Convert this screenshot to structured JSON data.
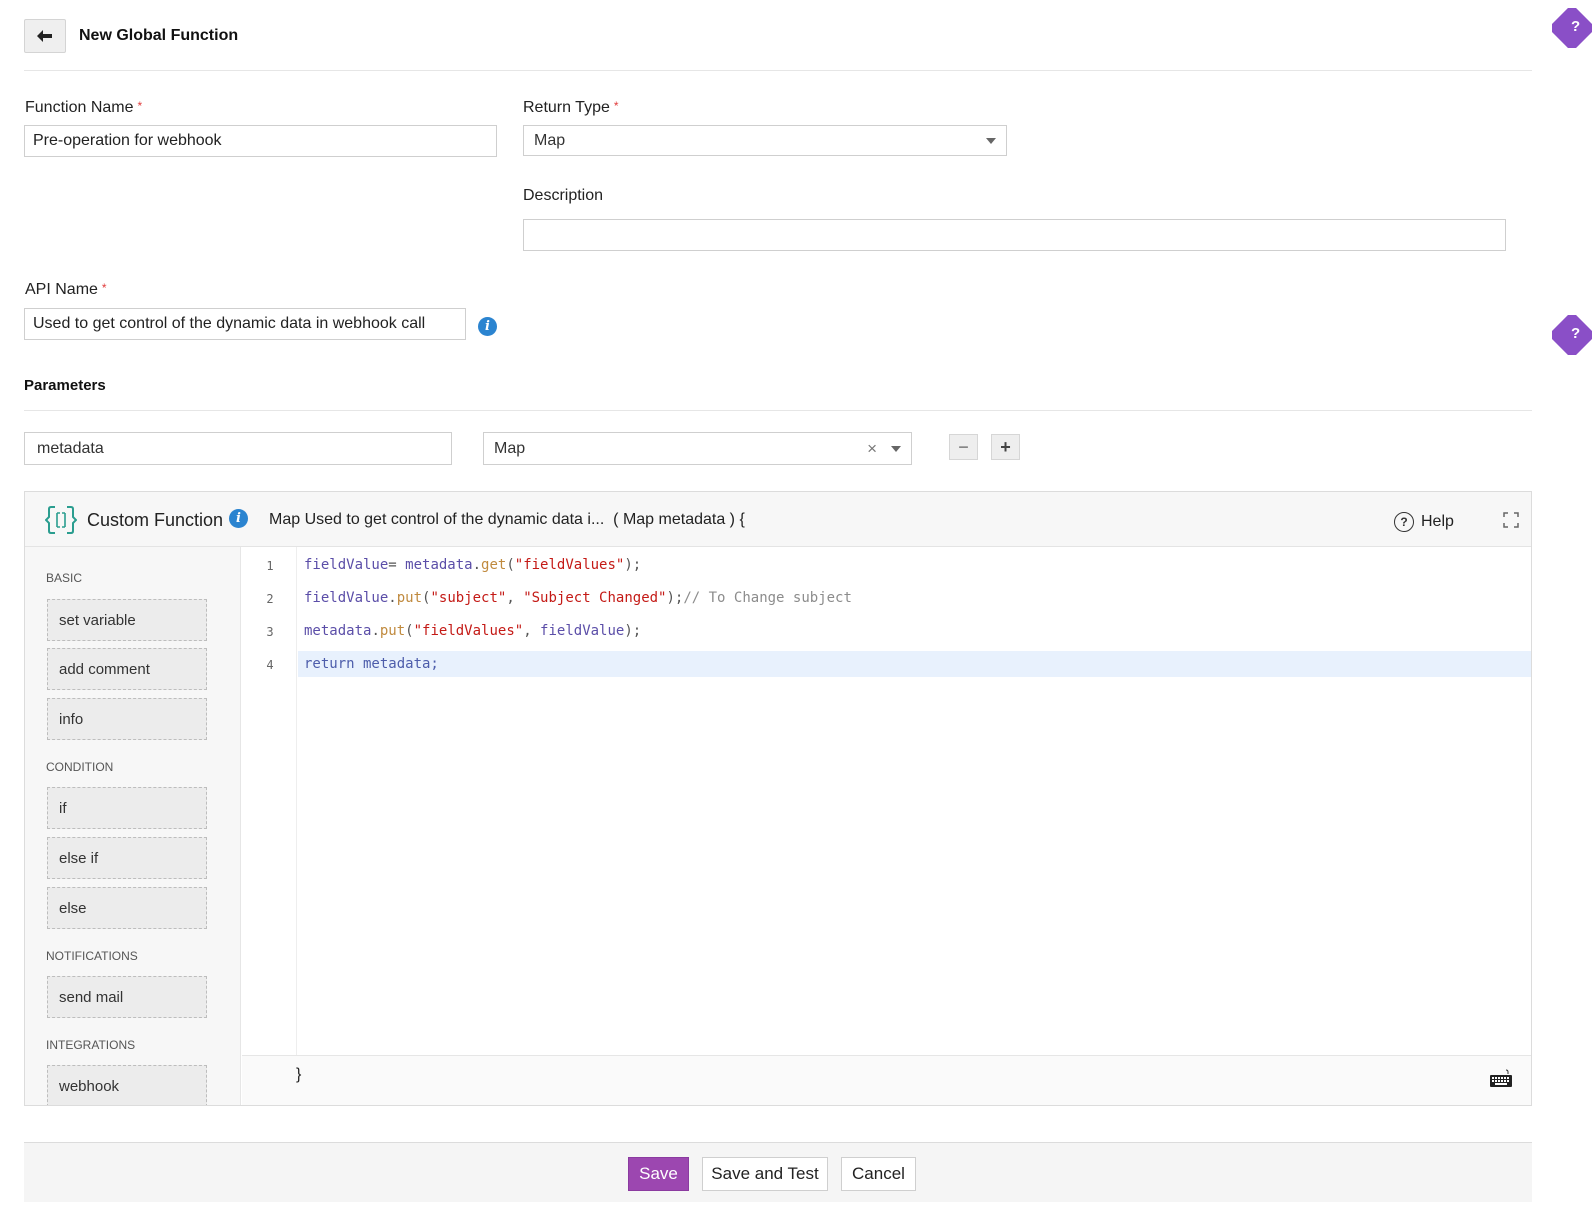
{
  "header": {
    "title": "New Global Function"
  },
  "form": {
    "function_name": {
      "label": "Function Name",
      "required": "*",
      "value": "Pre-operation for webhook"
    },
    "return_type": {
      "label": "Return Type",
      "required": "*",
      "value": "Map"
    },
    "description": {
      "label": "Description",
      "value": ""
    },
    "api_name": {
      "label": "API Name",
      "required": "*",
      "value": "Used to get control of the dynamic data in webhook call",
      "info_icon": "i"
    }
  },
  "parameters": {
    "title": "Parameters",
    "rows": [
      {
        "name": "metadata",
        "type": "Map",
        "clear": "×"
      }
    ],
    "remove_label": "−",
    "add_label": "+"
  },
  "editor": {
    "title": "Custom Function",
    "info_icon": "i",
    "signature": "Map Used to get control of the dynamic data i...  ( Map metadata ) {",
    "help_label": "Help",
    "help_icon": "?",
    "closing_brace": "}",
    "sidebar": {
      "categories": [
        {
          "name": "BASIC",
          "items": [
            "set variable",
            "add comment",
            "info"
          ]
        },
        {
          "name": "CONDITION",
          "items": [
            "if",
            "else if",
            "else"
          ]
        },
        {
          "name": "NOTIFICATIONS",
          "items": [
            "send mail"
          ]
        },
        {
          "name": "INTEGRATIONS",
          "items": [
            "webhook"
          ]
        }
      ]
    },
    "line_numbers": [
      "1",
      "2",
      "3",
      "4"
    ],
    "code_tokens": [
      {
        "t1": "fieldValue",
        "t2": "= ",
        "t3": "metadata",
        "t4": ".",
        "t5": "get",
        "t6": "(",
        "t7": "\"fieldValues\"",
        "t8": ");"
      },
      {
        "t1": "fieldValue",
        "t2": ".",
        "t3": "put",
        "t4": "(",
        "t5": "\"subject\"",
        "t6": ", ",
        "t7": "\"Subject Changed\"",
        "t8": ");",
        "t9": "// To Change subject"
      },
      {
        "t1": "metadata",
        "t2": ".",
        "t3": "put",
        "t4": "(",
        "t5": "\"fieldValues\"",
        "t6": ", ",
        "t7": "fieldValue",
        "t8": ");"
      },
      {
        "t1": "return",
        "t2": " metadata;"
      }
    ]
  },
  "actions": {
    "save": "Save",
    "save_and_test": "Save and Test",
    "cancel": "Cancel"
  },
  "side_help": {
    "label": "?"
  },
  "colors": {
    "primary": "#9c47b0",
    "info": "#2b84d0",
    "help_tab": "#8a4fc7",
    "required": "#e03b3b"
  }
}
